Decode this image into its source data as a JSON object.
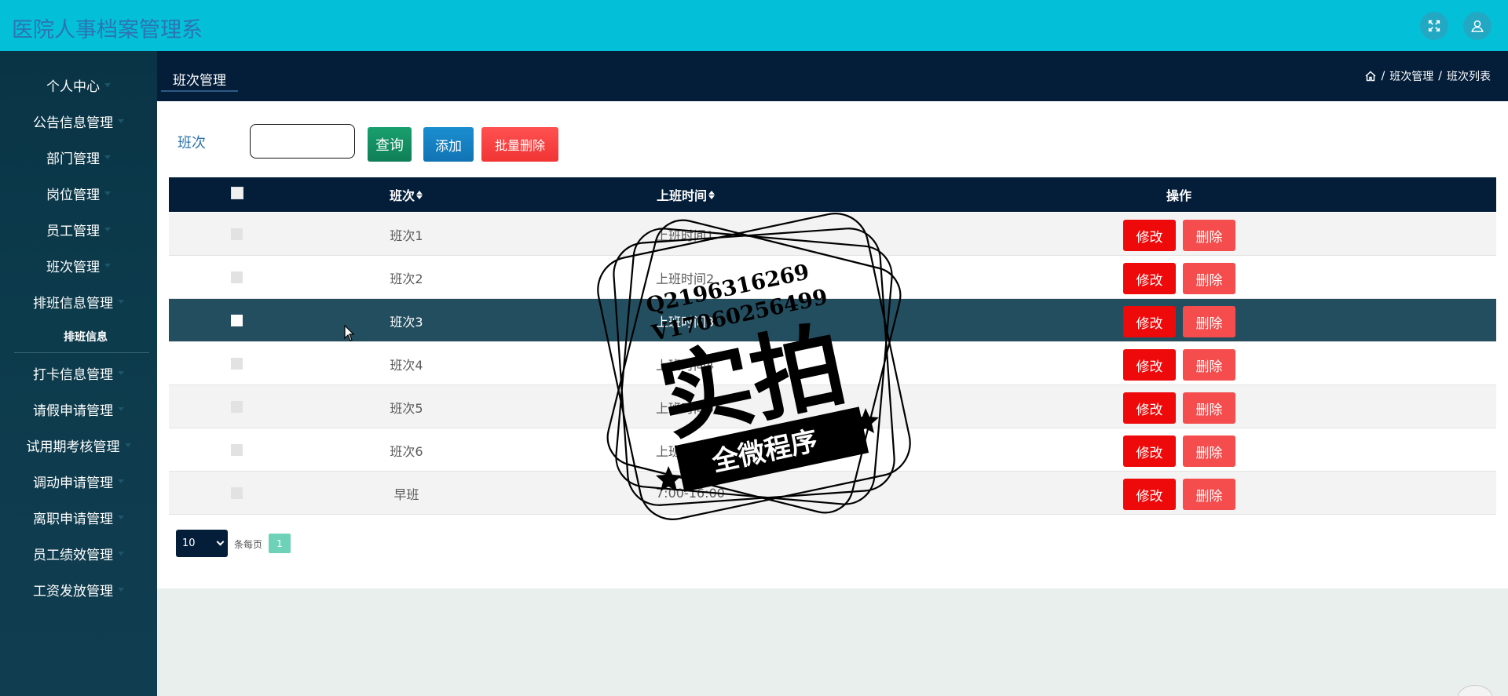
{
  "app": {
    "title": "医院人事档案管理系"
  },
  "sidebar": {
    "items": [
      {
        "label": "个人中心"
      },
      {
        "label": "公告信息管理"
      },
      {
        "label": "部门管理"
      },
      {
        "label": "岗位管理"
      },
      {
        "label": "员工管理"
      },
      {
        "label": "班次管理"
      },
      {
        "label": "排班信息管理"
      },
      {
        "label": "打卡信息管理"
      },
      {
        "label": "请假申请管理"
      },
      {
        "label": "试用期考核管理"
      },
      {
        "label": "调动申请管理"
      },
      {
        "label": "离职申请管理"
      },
      {
        "label": "员工绩效管理"
      },
      {
        "label": "工资发放管理"
      }
    ],
    "sub_item": "排班信息"
  },
  "tab": {
    "label": "班次管理"
  },
  "breadcrumb": {
    "level1": "班次管理",
    "sep": "/",
    "level2": "班次列表"
  },
  "search": {
    "label": "班次",
    "value": "",
    "query_label": "查询",
    "add_label": "添加",
    "bulk_delete_label": "批量删除"
  },
  "table": {
    "headers": {
      "name": "班次",
      "time": "上班时间",
      "ops": "操作"
    },
    "rows": [
      {
        "name": "班次1",
        "time": "上班时间1"
      },
      {
        "name": "班次2",
        "time": "上班时间2"
      },
      {
        "name": "班次3",
        "time": "上班时间3"
      },
      {
        "name": "班次4",
        "time": "上班时间4"
      },
      {
        "name": "班次5",
        "time": "上班时间5"
      },
      {
        "name": "班次6",
        "time": "上班时间6"
      },
      {
        "name": "早班",
        "time": "7:00-16:00"
      }
    ],
    "edit_label": "修改",
    "delete_label": "删除",
    "highlighted_row": 3
  },
  "pagination": {
    "page_size": "10",
    "per_page_label": "条每页",
    "current_page": "1"
  },
  "watermark": {
    "line1": "Q2196316269",
    "line2": "V17060256499",
    "main": "实拍",
    "ribbon": "全微程序"
  },
  "colors": {
    "header": "#04bfd8",
    "sidebar": "#0c3b4c",
    "navy": "#041e3a",
    "edit": "#ee0a0a",
    "delete": "#f54d4d"
  },
  "icons": [
    "fullscreen-icon",
    "user-icon",
    "home-icon",
    "sort-icon",
    "cursor-icon"
  ]
}
